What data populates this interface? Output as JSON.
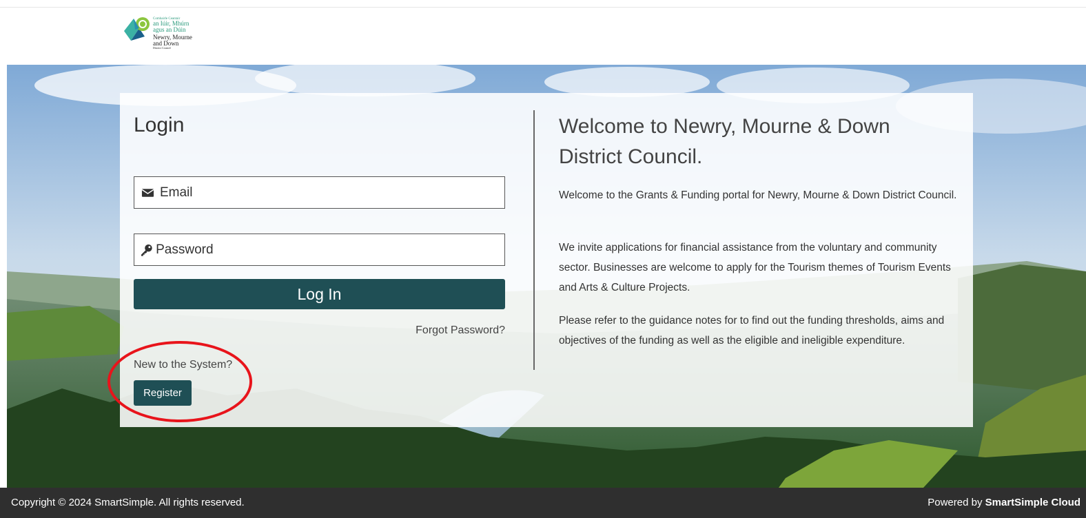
{
  "header": {
    "logo": {
      "line1": "Comhairle Ceantair",
      "line2": "an Iúir, Mhúrn",
      "line3": "agus an Dúin",
      "line4": "Newry, Mourne",
      "line5": "and Down",
      "line6": "District Council"
    }
  },
  "login": {
    "title": "Login",
    "email_placeholder": "Email",
    "password_placeholder": "Password",
    "login_button": "Log In",
    "forgot_password": "Forgot Password?",
    "new_to_system": "New to the System?",
    "register_button": "Register"
  },
  "welcome": {
    "title": "Welcome to Newry, Mourne & Down District Council.",
    "paragraph1": "Welcome to the Grants & Funding portal for Newry, Mourne & Down District Council.",
    "paragraph2": "We invite applications for financial assistance from the voluntary and community sector. Businesses are welcome to apply for the Tourism themes of Tourism Events and Arts & Culture Projects.",
    "paragraph3": "Please refer to the guidance notes for to find out the funding thresholds, aims and objectives of the funding as well as the eligible and ineligible expenditure."
  },
  "footer": {
    "copyright": "Copyright © 2024 SmartSimple. All rights reserved.",
    "powered_prefix": "Powered by",
    "powered_brand": "SmartSimple Cloud"
  },
  "colors": {
    "primary_button": "#1f4f55",
    "footer_bg": "#2f2f2f",
    "annotation": "#e8141b"
  },
  "icons": {
    "email": "envelope-icon",
    "password": "key-icon"
  }
}
